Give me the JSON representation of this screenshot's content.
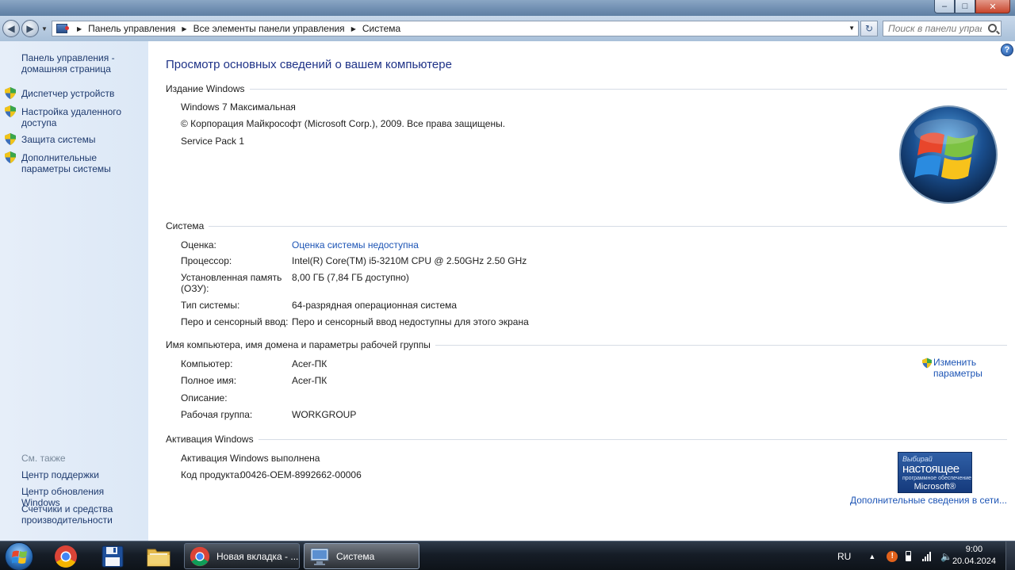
{
  "window": {
    "caption": {
      "min": "–",
      "max": "□",
      "close": "✕"
    }
  },
  "navbar": {
    "back_icon": "back-arrow-icon",
    "forward_icon": "forward-arrow-icon",
    "breadcrumbs": [
      "Панель управления",
      "Все элементы панели управления",
      "Система"
    ],
    "search_placeholder": "Поиск в панели управ..."
  },
  "sidebar": {
    "home": "Панель управления - домашняя страница",
    "tasks": [
      {
        "label": "Диспетчер устройств",
        "icon": "shield-icon"
      },
      {
        "label": "Настройка удаленного доступа",
        "icon": "shield-icon"
      },
      {
        "label": "Защита системы",
        "icon": "shield-icon"
      },
      {
        "label": "Дополнительные параметры системы",
        "icon": "shield-icon"
      }
    ],
    "see_also": "См. также",
    "see_also_links": [
      "Центр поддержки",
      "Центр обновления Windows",
      "Счетчики и средства производительности"
    ]
  },
  "main": {
    "title": "Просмотр основных сведений о вашем компьютере",
    "edition": {
      "heading": "Издание Windows",
      "name": "Windows 7 Максимальная",
      "copyright": "© Корпорация Майкрософт (Microsoft Corp.), 2009. Все права защищены.",
      "service_pack": "Service Pack 1"
    },
    "system": {
      "heading": "Система",
      "rows": [
        {
          "label": "Оценка:",
          "value": "Оценка системы недоступна"
        },
        {
          "label": "Процессор:",
          "value": "Intel(R) Core(TM) i5-3210M CPU @ 2.50GHz   2.50 GHz"
        },
        {
          "label": "Установленная память (ОЗУ):",
          "value": "8,00 ГБ (7,84 ГБ доступно)"
        },
        {
          "label": "Тип системы:",
          "value": "64-разрядная операционная система"
        },
        {
          "label": "Перо и сенсорный ввод:",
          "value": "Перо и сенсорный ввод недоступны для этого экрана"
        }
      ]
    },
    "computer": {
      "heading": "Имя компьютера, имя домена и параметры рабочей группы",
      "rows": [
        {
          "label": "Компьютер:",
          "value": "Acer-ПК"
        },
        {
          "label": "Полное имя:",
          "value": "Acer-ПК"
        },
        {
          "label": "Описание:",
          "value": ""
        },
        {
          "label": "Рабочая группа:",
          "value": "WORKGROUP"
        }
      ],
      "change_link": "Изменить параметры"
    },
    "activation": {
      "heading": "Активация Windows",
      "status": "Активация Windows выполнена",
      "product_key_label": "Код продукта:",
      "product_key": "00426-OEM-8992662-00006",
      "genuine_badge": {
        "line1": "Выбирай",
        "line2": "настоящее",
        "line3": "программное обеспечение",
        "line4": "Microsoft®"
      },
      "more_link": "Дополнительные сведения в сети..."
    }
  },
  "taskbar": {
    "pinned": [
      "chrome-icon",
      "floppy-disk-icon",
      "folder-icon"
    ],
    "windows": [
      {
        "label": "Новая вкладка - ...",
        "icon": "chrome-icon"
      },
      {
        "label": "Система",
        "icon": "system-monitor-icon"
      }
    ],
    "tray": {
      "language": "RU",
      "time": "9:00",
      "date": "20.04.2024"
    }
  },
  "colors": {
    "link": "#1c54b5",
    "title": "#1e3287",
    "sidebar_bg": "#dce8f6"
  }
}
